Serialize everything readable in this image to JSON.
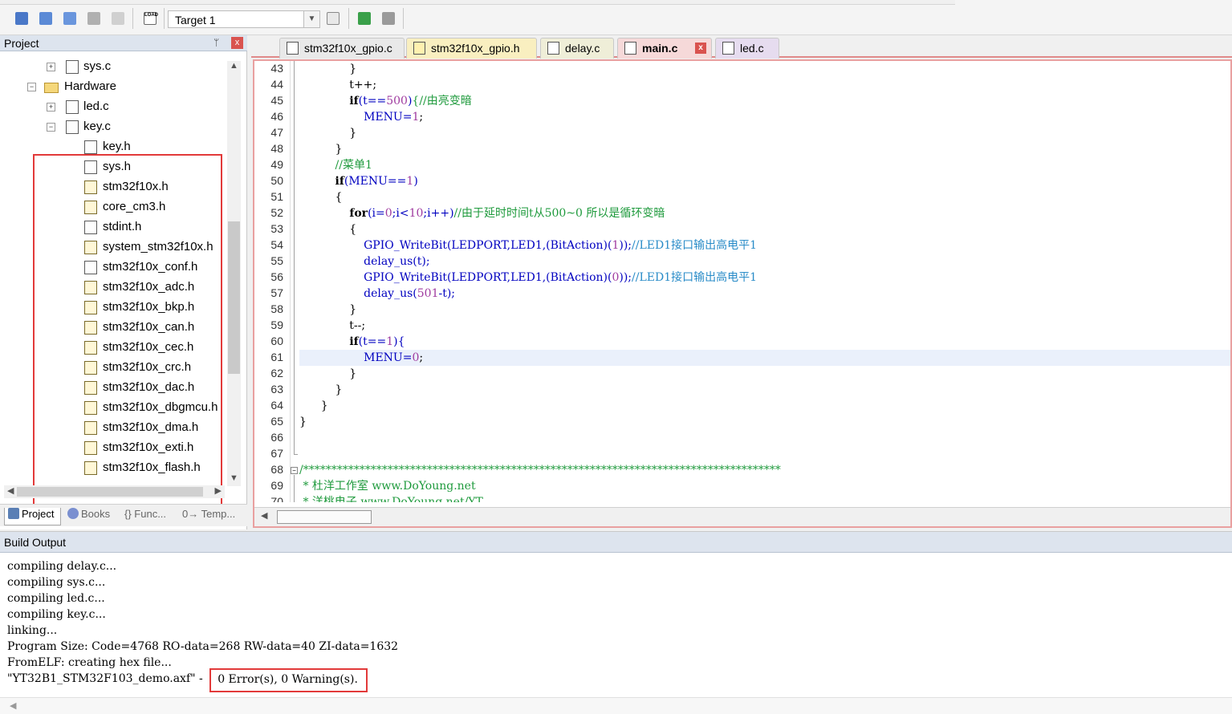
{
  "toolbar": {
    "target_label": "Target 1",
    "load_label": "LOAD"
  },
  "project_panel": {
    "title": "Project",
    "pin": "ᛘ",
    "close": "x",
    "tree": [
      {
        "label": "sys.c",
        "icon": "c-file-icon",
        "expander": "+"
      },
      {
        "label": "Hardware",
        "icon": "folder-icon",
        "expander": "−"
      },
      {
        "label": "led.c",
        "icon": "c-file-icon",
        "expander": "+"
      },
      {
        "label": "key.c",
        "icon": "c-file-icon",
        "expander": "−"
      },
      {
        "label": "key.h",
        "icon": "h-file-icon"
      },
      {
        "label": "sys.h",
        "icon": "h-file-icon"
      },
      {
        "label": "stm32f10x.h",
        "icon": "h-locked-file-icon"
      },
      {
        "label": "core_cm3.h",
        "icon": "h-locked-file-icon"
      },
      {
        "label": "stdint.h",
        "icon": "h-file-icon"
      },
      {
        "label": "system_stm32f10x.h",
        "icon": "h-locked-file-icon"
      },
      {
        "label": "stm32f10x_conf.h",
        "icon": "h-file-icon"
      },
      {
        "label": "stm32f10x_adc.h",
        "icon": "h-locked-file-icon"
      },
      {
        "label": "stm32f10x_bkp.h",
        "icon": "h-locked-file-icon"
      },
      {
        "label": "stm32f10x_can.h",
        "icon": "h-locked-file-icon"
      },
      {
        "label": "stm32f10x_cec.h",
        "icon": "h-locked-file-icon"
      },
      {
        "label": "stm32f10x_crc.h",
        "icon": "h-locked-file-icon"
      },
      {
        "label": "stm32f10x_dac.h",
        "icon": "h-locked-file-icon"
      },
      {
        "label": "stm32f10x_dbgmcu.h",
        "icon": "h-locked-file-icon"
      },
      {
        "label": "stm32f10x_dma.h",
        "icon": "h-locked-file-icon"
      },
      {
        "label": "stm32f10x_exti.h",
        "icon": "h-locked-file-icon"
      },
      {
        "label": "stm32f10x_flash.h",
        "icon": "h-locked-file-icon"
      }
    ],
    "bottom_tabs": [
      {
        "label": "Project",
        "icon": "project-icon"
      },
      {
        "label": "Books",
        "icon": "books-icon"
      },
      {
        "label": "{} Func...",
        "icon": "functions-icon"
      },
      {
        "label": "0→ Temp...",
        "icon": "templates-icon"
      }
    ]
  },
  "editor": {
    "tabs": [
      {
        "label": "stm32f10x_gpio.c",
        "icon": "c-file-icon"
      },
      {
        "label": "stm32f10x_gpio.h",
        "icon": "h-file-icon"
      },
      {
        "label": "delay.c",
        "icon": "c-file-icon"
      },
      {
        "label": "main.c",
        "icon": "c-file-icon",
        "active": true,
        "close": "x"
      },
      {
        "label": "led.c",
        "icon": "c-file-icon"
      }
    ],
    "line_numbers": [
      "43",
      "44",
      "45",
      "46",
      "47",
      "48",
      "49",
      "50",
      "51",
      "52",
      "53",
      "54",
      "55",
      "56",
      "57",
      "58",
      "59",
      "60",
      "61",
      "62",
      "63",
      "64",
      "65",
      "66",
      "67",
      "68",
      "69",
      "70"
    ],
    "current_line": "61"
  },
  "build_output": {
    "title": "Build Output",
    "lines": [
      "compiling delay.c...",
      "compiling sys.c...",
      "compiling led.c...",
      "compiling key.c...",
      "linking...",
      "Program Size: Code=4768 RO-data=268 RW-data=40 ZI-data=1632",
      "FromELF: creating hex file..."
    ],
    "final_prefix": "\"YT32B1_STM32F103_demo.axf\" - ",
    "final_result": "0 Error(s), 0 Warning(s)."
  },
  "colors": {
    "highlight_red": "#e23a3a",
    "comment_green": "#1e9a3c",
    "number_purple": "#a03ca0",
    "panel_header": "#dde4ee"
  }
}
